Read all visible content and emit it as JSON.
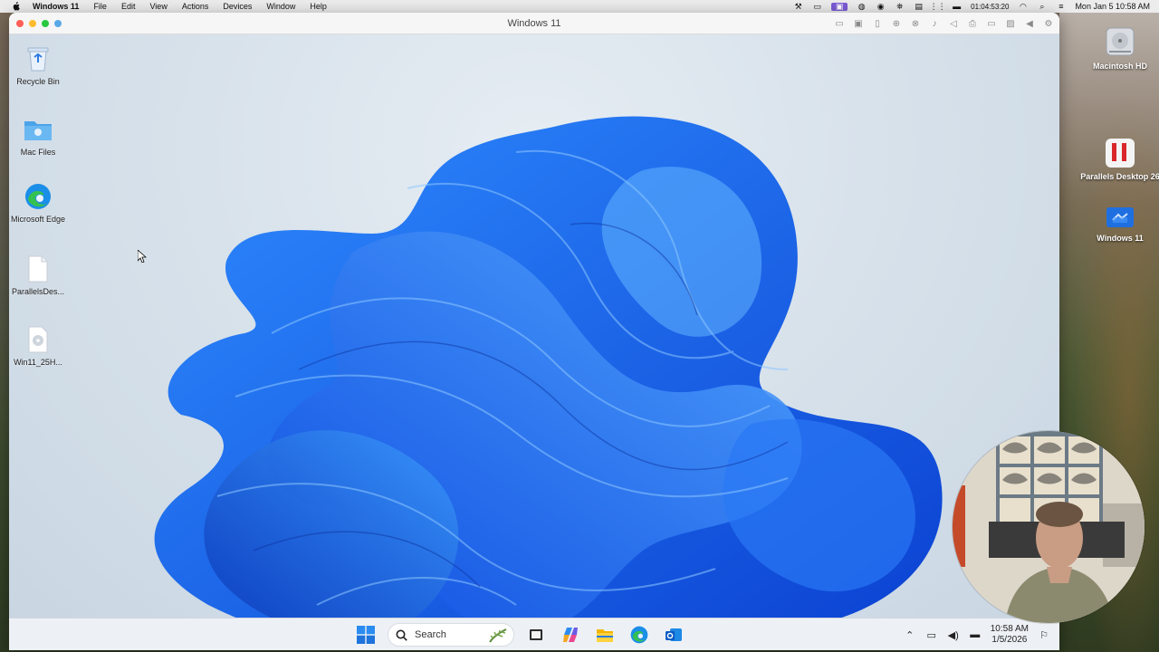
{
  "menubar": {
    "app_name": "Windows 11",
    "items": [
      "File",
      "Edit",
      "View",
      "Actions",
      "Devices",
      "Window",
      "Help"
    ],
    "timer": "01:04:53:20",
    "datetime": "Mon Jan 5  10:58 AM"
  },
  "vm_window": {
    "title": "Windows 11"
  },
  "win_desktop_icons": [
    {
      "label": "Recycle Bin",
      "icon": "recycle-bin-icon"
    },
    {
      "label": "Mac Files",
      "icon": "folder-icon"
    },
    {
      "label": "Microsoft Edge",
      "icon": "edge-icon"
    },
    {
      "label": "ParallelsDes...",
      "icon": "file-icon"
    },
    {
      "label": "Win11_25H...",
      "icon": "disc-image-icon"
    }
  ],
  "taskbar": {
    "search_placeholder": "Search",
    "time": "10:58 AM",
    "date": "1/5/2026"
  },
  "mac_desktop": {
    "icons": [
      {
        "label": "Macintosh HD",
        "icon": "hard-drive-icon"
      },
      {
        "label": "Parallels Desktop 26",
        "icon": "parallels-icon"
      },
      {
        "label": "Windows 11",
        "icon": "vm-icon"
      }
    ]
  },
  "colors": {
    "accent": "#1a63e8",
    "parallels_red": "#d9262b",
    "menubar_highlight": "#7b5cd6"
  }
}
